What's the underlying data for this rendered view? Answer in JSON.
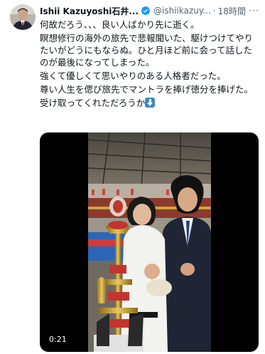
{
  "author": {
    "display_name": "Ishii Kazuyoshi石井...",
    "handle": "@ishiikazuy...",
    "separator": "·",
    "time": "18時間",
    "verified": true,
    "avatar_icon": "user-avatar"
  },
  "more_icon": "more-icon",
  "tweet": {
    "lines": [
      "何故だろう、、、良い人ばかり先に逝く。",
      "瞑想修行の海外の旅先で悲報聞いた、駆けつけてやりたいがどうにもならぬ。ひと月ほど前に会って話したのが最後になってしまった。",
      "強くて優しくて思いやりのある人格者だった。",
      "尊い人生を偲び旅先でマントラを捧げ徳分を捧げた。",
      "受け取ってくれただろうか"
    ],
    "emoji": "down-arrow-emoji"
  },
  "media": {
    "type": "video",
    "duration": "0:21"
  },
  "colors": {
    "text": "#0f1419",
    "secondary": "#536471",
    "verified": "#1d9bf0",
    "emoji": "#3b88c3"
  }
}
